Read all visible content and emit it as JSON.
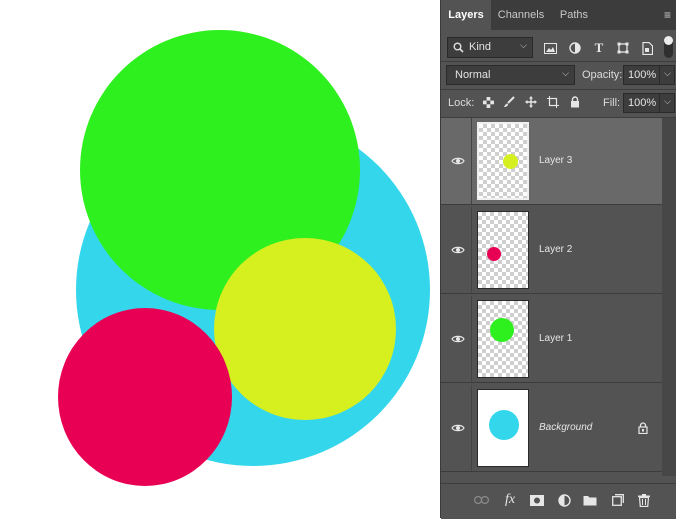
{
  "canvas": {
    "circles": [
      {
        "name": "cyan-circle",
        "color": "#34d6ec"
      },
      {
        "name": "green-circle",
        "color": "#2ef01f"
      },
      {
        "name": "yellow-circle",
        "color": "#d6ef1f"
      },
      {
        "name": "red-circle",
        "color": "#e80054"
      }
    ]
  },
  "panel": {
    "tabs": [
      {
        "label": "Layers",
        "active": true
      },
      {
        "label": "Channels",
        "active": false
      },
      {
        "label": "Paths",
        "active": false
      }
    ],
    "filter": {
      "value": "Kind",
      "icon": "search-icon"
    },
    "blend_mode": {
      "value": "Normal"
    },
    "opacity": {
      "label": "Opacity:",
      "value": "100%"
    },
    "lock": {
      "label": "Lock:"
    },
    "fill": {
      "label": "Fill:",
      "value": "100%"
    },
    "layers": [
      {
        "name": "Layer 3",
        "selected": true,
        "thumb_color": "#d6ef1f",
        "visible": true
      },
      {
        "name": "Layer 2",
        "selected": false,
        "thumb_color": "#e80054",
        "visible": true
      },
      {
        "name": "Layer 1",
        "selected": false,
        "thumb_color": "#2ef01f",
        "visible": true
      },
      {
        "name": "Background",
        "selected": false,
        "thumb_color": "#34d6ec",
        "visible": true,
        "locked": true
      }
    ],
    "footer_icons": [
      "link-icon",
      "fx-icon",
      "mask-icon",
      "adjustment-icon",
      "folder-icon",
      "new-layer-icon",
      "trash-icon"
    ],
    "footer_fx_label": "fx"
  }
}
